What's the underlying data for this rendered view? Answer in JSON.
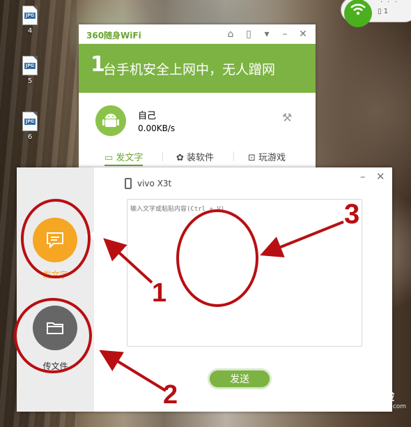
{
  "desktop": {
    "icons": [
      {
        "ext": "JPG",
        "label": "4"
      },
      {
        "ext": "JPG",
        "label": "5"
      },
      {
        "ext": "JPG",
        "label": "6"
      }
    ]
  },
  "tray": {
    "icon": "wifi-icon",
    "connected_count": "1",
    "accent": "#4caf1e"
  },
  "wifi_window": {
    "logo": "360随身WiFi",
    "controls": [
      "share-icon",
      "phone-icon",
      "menu-icon",
      "minimize-icon",
      "close-icon"
    ],
    "banner_number": "1",
    "banner_text": "台手机安全上网中，无人蹭网",
    "device": {
      "name": "自己",
      "speed": "0.00KB/s"
    },
    "tabs": [
      {
        "label": "发文字",
        "icon": "message-icon",
        "active": true
      },
      {
        "label": "装软件",
        "icon": "apps-icon",
        "active": false
      },
      {
        "label": "玩游戏",
        "icon": "gamepad-icon",
        "active": false
      }
    ],
    "brand_color": "#7cb342"
  },
  "send_dialog": {
    "sidebar": [
      {
        "label": "发文字",
        "icon": "message-icon",
        "active": true,
        "color": "#f5a623"
      },
      {
        "label": "传文件",
        "icon": "folder-icon",
        "active": false,
        "color": "#666666"
      }
    ],
    "device_name": "vivo X3t",
    "text_placeholder": "输入文字或粘贴内容(Ctrl + V)",
    "text_value": "",
    "send_label": "发送"
  },
  "annotations": {
    "labels": [
      "1",
      "2",
      "3"
    ],
    "color": "#b80f12"
  },
  "watermark": {
    "brand": "Bai du 经验",
    "url": "jingyan.baidu.com"
  }
}
